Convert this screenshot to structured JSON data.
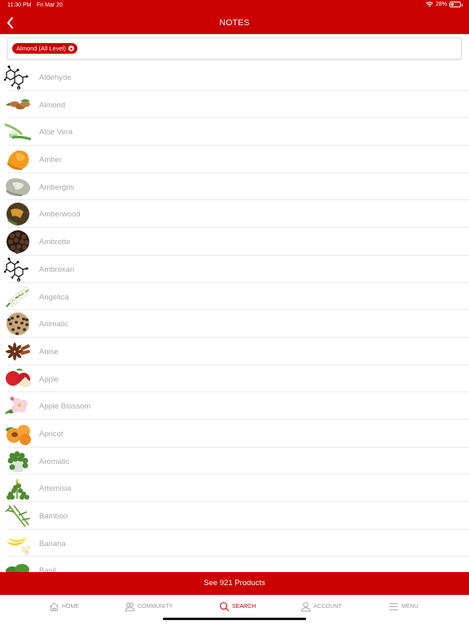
{
  "status_bar": {
    "time": "11:30 PM",
    "date": "Fri Mar 20",
    "battery_percent": "28%",
    "battery_level": 0.28
  },
  "nav": {
    "title": "NOTES",
    "back_icon": "chevron-left-icon"
  },
  "filter": {
    "chips": [
      {
        "label": "Almond (All Level)",
        "remove_icon": "close-circle-icon"
      }
    ]
  },
  "notes": [
    {
      "name": "Aldehyde",
      "icon": "molecule"
    },
    {
      "name": "Almond",
      "icon": "almond"
    },
    {
      "name": "Aloe Vera",
      "icon": "aloe"
    },
    {
      "name": "Amber",
      "icon": "amber"
    },
    {
      "name": "Ambergris",
      "icon": "stone"
    },
    {
      "name": "Amberwood",
      "icon": "circle-wood"
    },
    {
      "name": "Ambrette",
      "icon": "circle-seeds"
    },
    {
      "name": "Ambroxan",
      "icon": "molecule"
    },
    {
      "name": "Angelica",
      "icon": "flower-white"
    },
    {
      "name": "Animalic",
      "icon": "circle-leopard"
    },
    {
      "name": "Anise",
      "icon": "star-anise"
    },
    {
      "name": "Apple",
      "icon": "apple"
    },
    {
      "name": "Apple Blossom",
      "icon": "blossom"
    },
    {
      "name": "Apricot",
      "icon": "apricot"
    },
    {
      "name": "Aromatic",
      "icon": "herbs"
    },
    {
      "name": "Artemisia",
      "icon": "artemisia"
    },
    {
      "name": "Bamboo",
      "icon": "bamboo"
    },
    {
      "name": "Banana",
      "icon": "banana"
    },
    {
      "name": "Basil",
      "icon": "basil"
    }
  ],
  "cta": {
    "label": "See 921 Products"
  },
  "tabbar": {
    "items": [
      {
        "label": "HOME",
        "icon": "home-icon",
        "active": false
      },
      {
        "label": "COMMUNITY",
        "icon": "community-icon",
        "active": false
      },
      {
        "label": "SEARCH",
        "icon": "search-icon",
        "active": true
      },
      {
        "label": "ACCOUNT",
        "icon": "account-icon",
        "active": false
      },
      {
        "label": "MENU",
        "icon": "menu-icon",
        "active": false
      }
    ]
  },
  "colors": {
    "brand": "#cc0000",
    "label": "#aaaaaa",
    "tab_inactive": "#999999"
  }
}
